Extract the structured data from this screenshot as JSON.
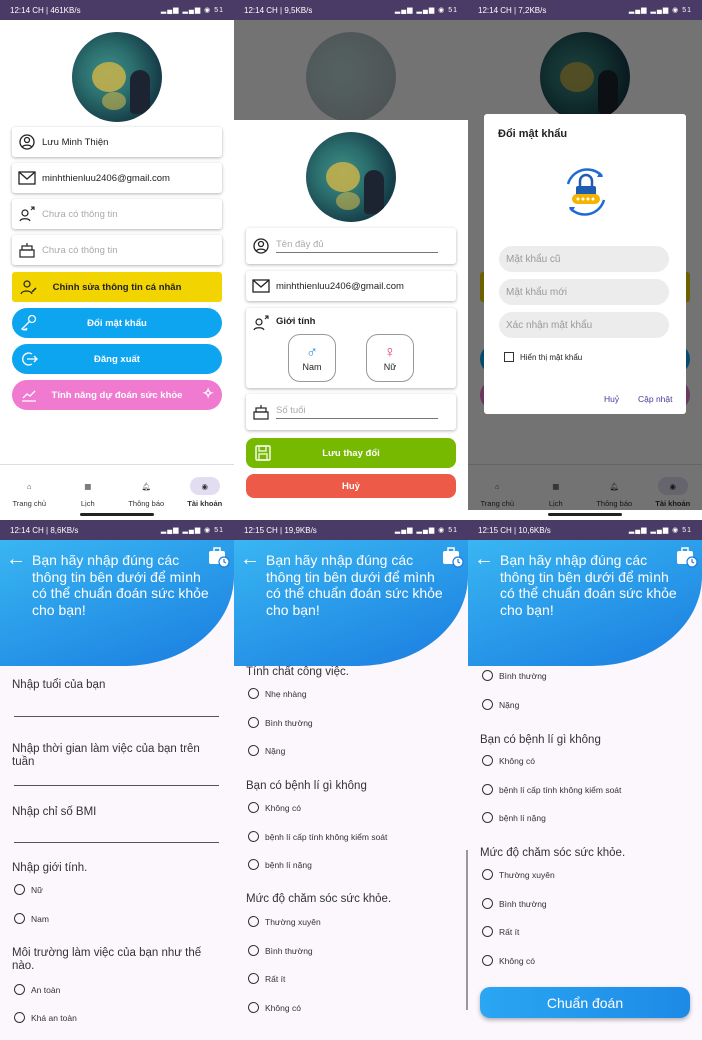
{
  "status": [
    {
      "time": "12:14 CH | 461KB/s",
      "right": "▂▄▆ ▂▄▆ ◉ 51"
    },
    {
      "time": "12:14 CH | 9,5KB/s",
      "right": "▂▄▆ ▂▄▆ ◉ 51"
    },
    {
      "time": "12:14 CH | 7,2KB/s",
      "right": "▂▄▆ ▂▄▆ ◉ 51"
    },
    {
      "time": "12:14 CH | 8,6KB/s",
      "right": "▂▄▆ ▂▄▆ ◉ 51"
    },
    {
      "time": "12:15 CH | 19,9KB/s",
      "right": "▂▄▆ ▂▄▆ ◉ 51"
    },
    {
      "time": "12:15 CH | 10,6KB/s",
      "right": "▂▄▆ ▂▄▆ ◉ 51"
    }
  ],
  "profile": {
    "name": "Lưu Minh Thiện",
    "email": "minhthienluu2406@gmail.com",
    "gender_placeholder": "Chưa có thông tin",
    "age_placeholder": "Chưa có thông tin",
    "edit_btn": "Chỉnh sửa thông tin cá nhân",
    "change_pw_btn": "Đổi mật khẩu",
    "logout_btn": "Đăng xuất",
    "predict_btn": "Tính năng dự đoán sức khỏe"
  },
  "nav": [
    "Trang chủ",
    "Lịch",
    "Thông báo",
    "Tài khoản"
  ],
  "edit": {
    "fullname_placeholder": "Tên đầy đủ",
    "email": "minhthienluu2406@gmail.com",
    "gender_label": "Giới tính",
    "male": "Nam",
    "female": "Nữ",
    "age_placeholder": "Số tuổi",
    "save_btn": "Lưu thay đổi",
    "cancel_btn": "Huỷ"
  },
  "dialog": {
    "title": "Đổi mật khẩu",
    "old_pw": "Mật khẩu cũ",
    "new_pw": "Mật khẩu mới",
    "confirm_pw": "Xác nhận mật khẩu",
    "show_pw": "Hiển thị mật khẩu",
    "cancel": "Huỷ",
    "update": "Cập nhật"
  },
  "predict": {
    "header": "Bạn hãy nhập đúng các thông tin bên dưới để mình có thể chuẩn đoán sức khỏe cho bạn!",
    "q_age": "Nhập tuổi của bạn",
    "q_hours": "Nhập thời gian làm việc của bạn trên tuần",
    "q_bmi": "Nhập chỉ số BMI",
    "q_gender": "Nhập giới tính.",
    "g_opts": [
      "Nữ",
      "Nam"
    ],
    "q_env": "Môi trường làm việc của bạn như thế nào.",
    "env_opts": [
      "An toàn",
      "Khá an toàn"
    ],
    "q_work": "Tính chất công việc.",
    "work_opts": [
      "Nhẹ nhàng",
      "Bình thường",
      "Nặng"
    ],
    "q_disease": "Bạn có bệnh lí gì không",
    "disease_opts": [
      "Không có",
      "bệnh lí cấp tính không kiểm soát",
      "bệnh lí nặng"
    ],
    "q_care": "Mức độ chăm sóc sức khỏe.",
    "care_opts": [
      "Thường xuyên",
      "Bình thường",
      "Rất ít",
      "Không có"
    ],
    "diagnose_btn": "Chuẩn đoán"
  }
}
